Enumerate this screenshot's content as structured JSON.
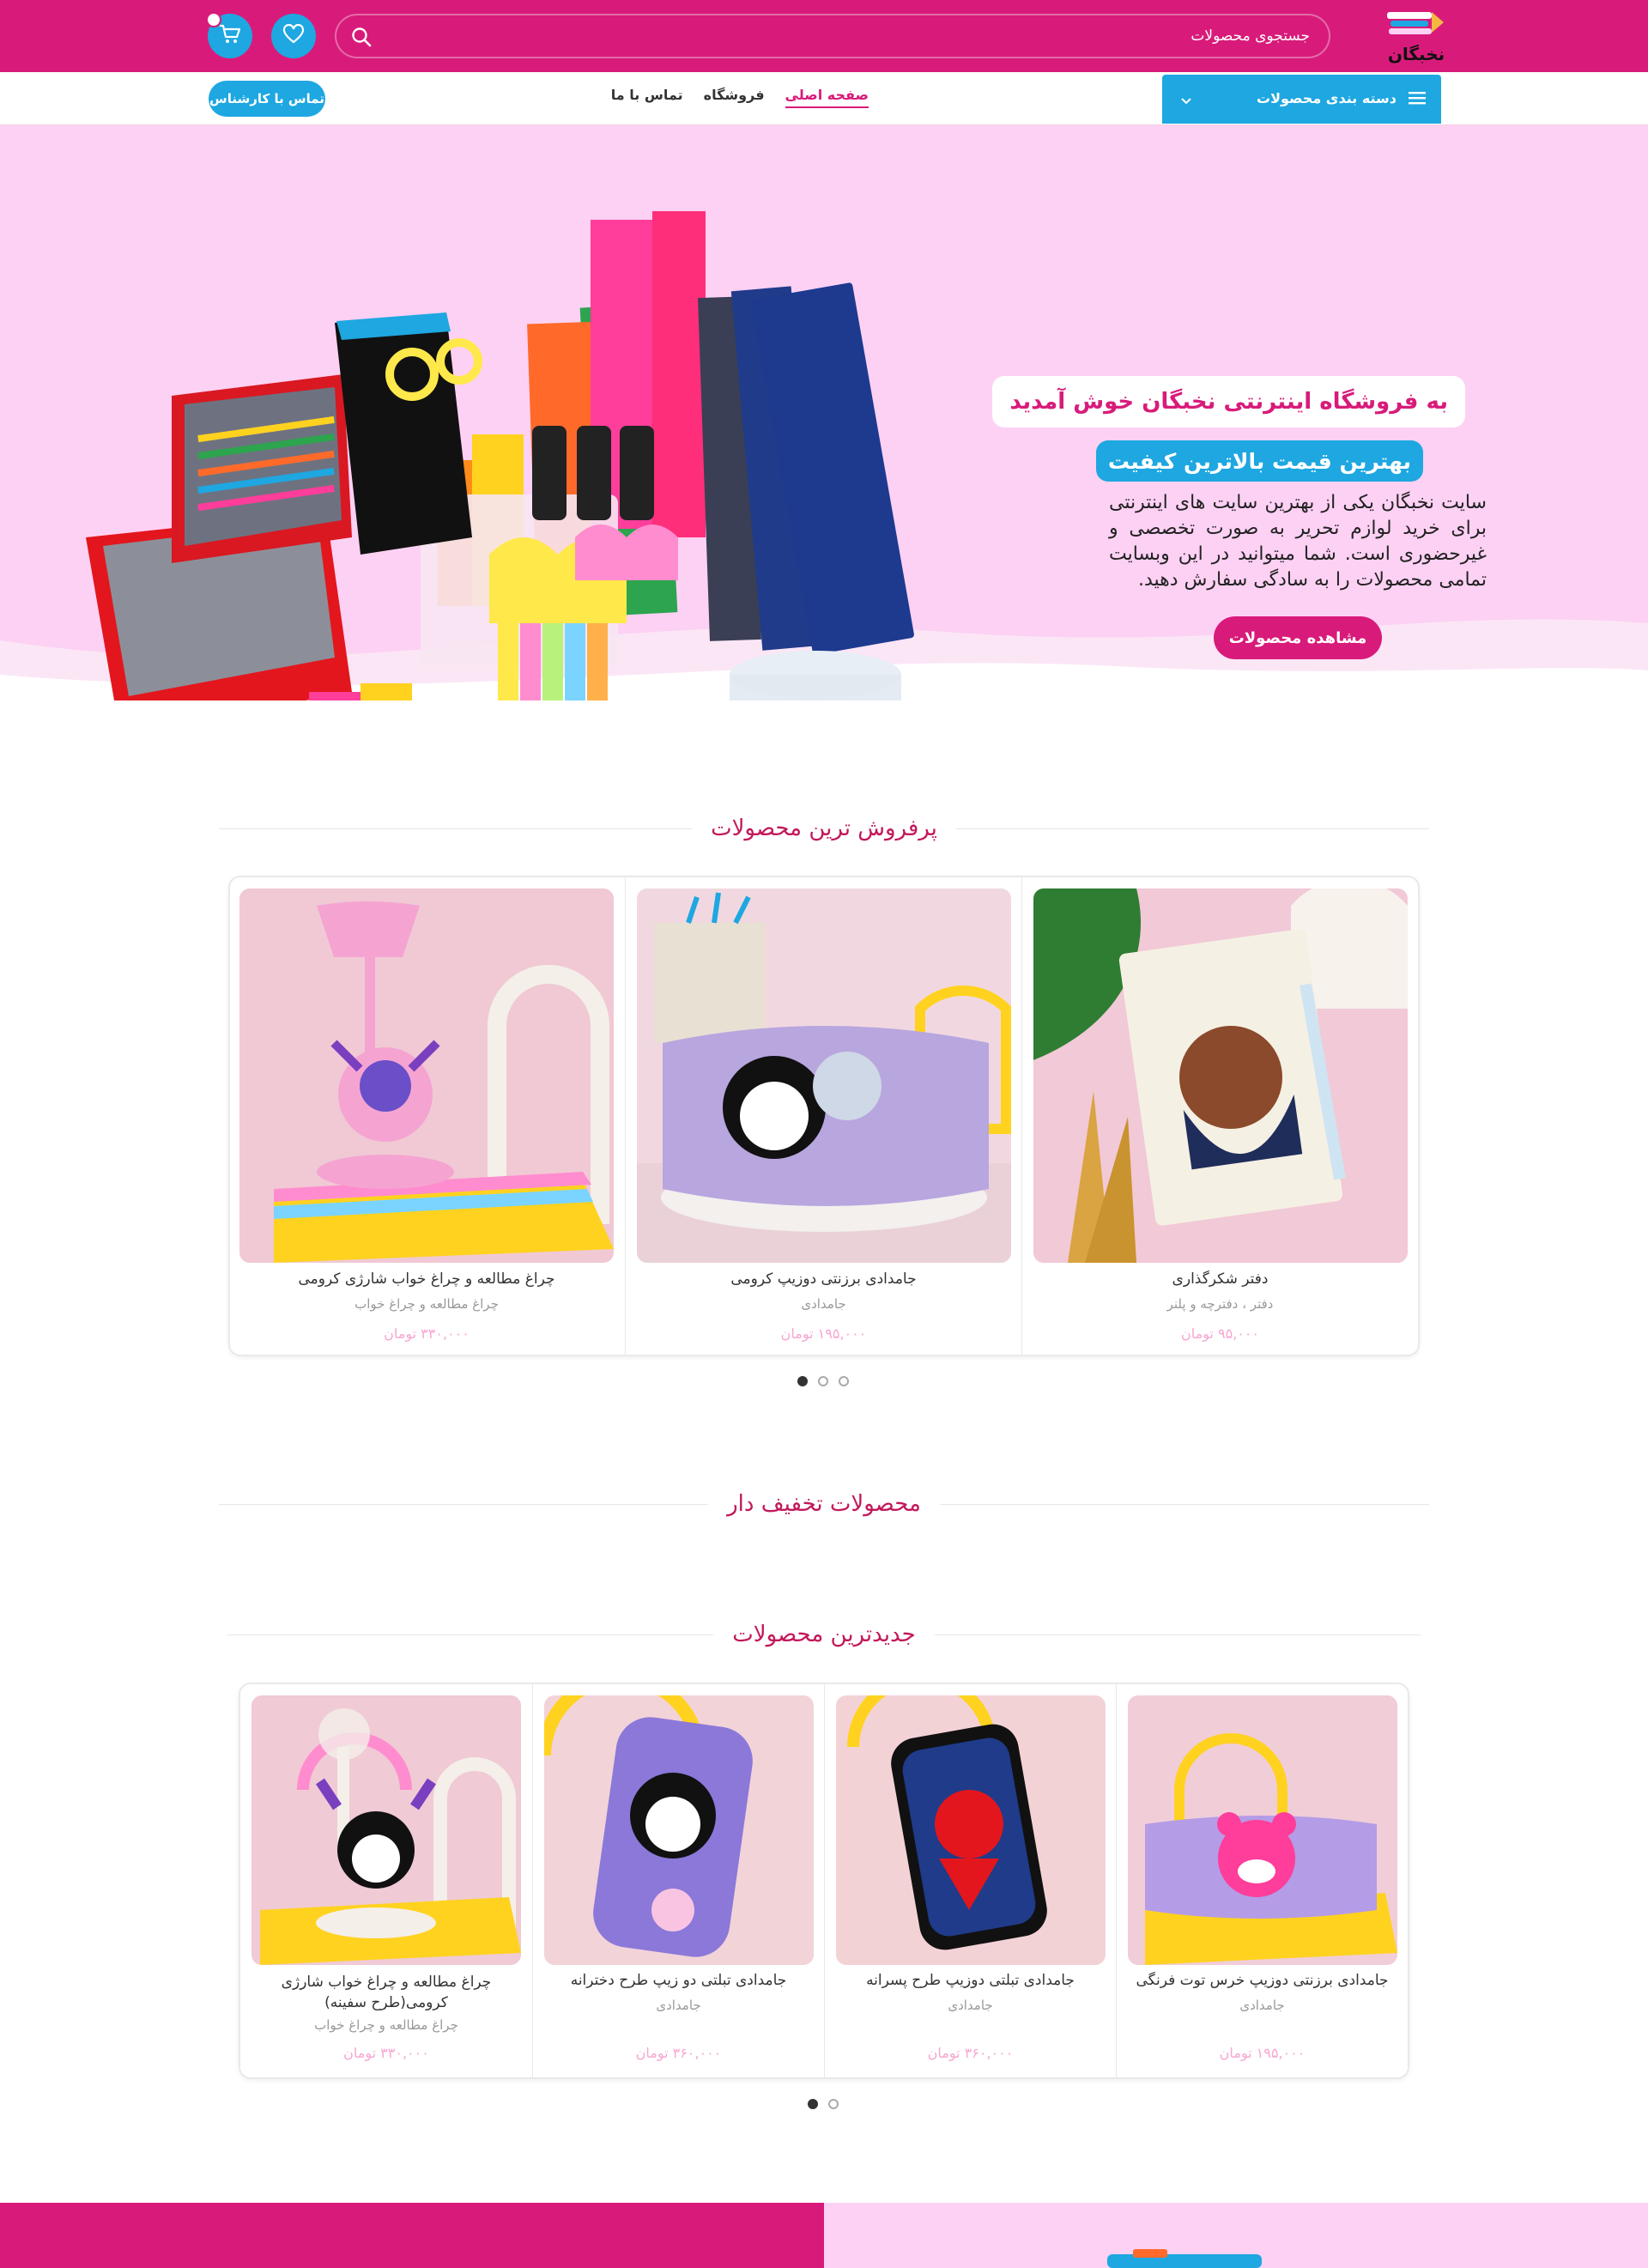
{
  "header": {
    "search_placeholder": "جستجوی محصولات",
    "logo_text": "نخبگان"
  },
  "nav": {
    "categories_label": "دسته بندی محصولات",
    "links": [
      "صفحه اصلی",
      "فروشگاه",
      "تماس با ما"
    ],
    "active_link": "صفحه اصلی",
    "consult_label": "تماس با کارشناس"
  },
  "hero": {
    "welcome": "به فروشگاه اینترنتی نخبگان خوش آمدید",
    "tagline": "بهترین قیمت بالاترین کیفیت",
    "description": "سایت نخبگان یکی از بهترین سایت های اینترنتی برای خرید لوازم تحریر به صورت تخصصی و غیرحضوری است. شما میتوانید در این وبسایت تمامی محصولات را به سادگی سفارش دهید.",
    "cta_label": "مشاهده محصولات"
  },
  "bestsellers": {
    "title": "پرفروش ترین محصولات",
    "products": [
      {
        "name": "دفتر شکرگذاری",
        "category": "دفتر ، دفترچه و پلنر",
        "price": "۹۵,۰۰۰ تومان"
      },
      {
        "name": "جامدادی برزنتی دوزیپ کرومی",
        "category": "جامدادی",
        "price": "۱۹۵,۰۰۰ تومان"
      },
      {
        "name": "چراغ مطالعه و چراغ خواب شارژی کرومی",
        "category": "چراغ مطالعه و چراغ خواب",
        "price": "۳۳۰,۰۰۰ تومان"
      }
    ],
    "dots": 3,
    "active_dot": 0
  },
  "discounted": {
    "title": "محصولات تخفیف دار"
  },
  "newest": {
    "title": "جدیدترین محصولات",
    "products": [
      {
        "name": "جامدادی برزنتی دوزیپ خرس توت فرنگی",
        "category": "جامدادی",
        "price": "۱۹۵,۰۰۰ تومان"
      },
      {
        "name": "جامدادی تبلتی دوزیپ طرح پسرانه",
        "category": "جامدادی",
        "price": "۳۶۰,۰۰۰ تومان"
      },
      {
        "name": "جامدادی تبلتی دو زیپ طرح دخترانه",
        "category": "جامدادی",
        "price": "۳۶۰,۰۰۰ تومان"
      },
      {
        "name": "چراغ مطالعه و چراغ خواب شارژی کرومی(طرح سفینه)",
        "category": "چراغ مطالعه و چراغ خواب",
        "price": "۳۳۰,۰۰۰ تومان"
      }
    ],
    "dots": 2,
    "active_dot": 0
  },
  "colors": {
    "primary": "#d81b7a",
    "accent": "#1ea7e1",
    "hero_bg": "#fdd1f4",
    "price": "#f7a6d2"
  },
  "icons": [
    "search-icon",
    "heart-icon",
    "cart-icon",
    "menu-icon",
    "chevron-down-icon"
  ]
}
